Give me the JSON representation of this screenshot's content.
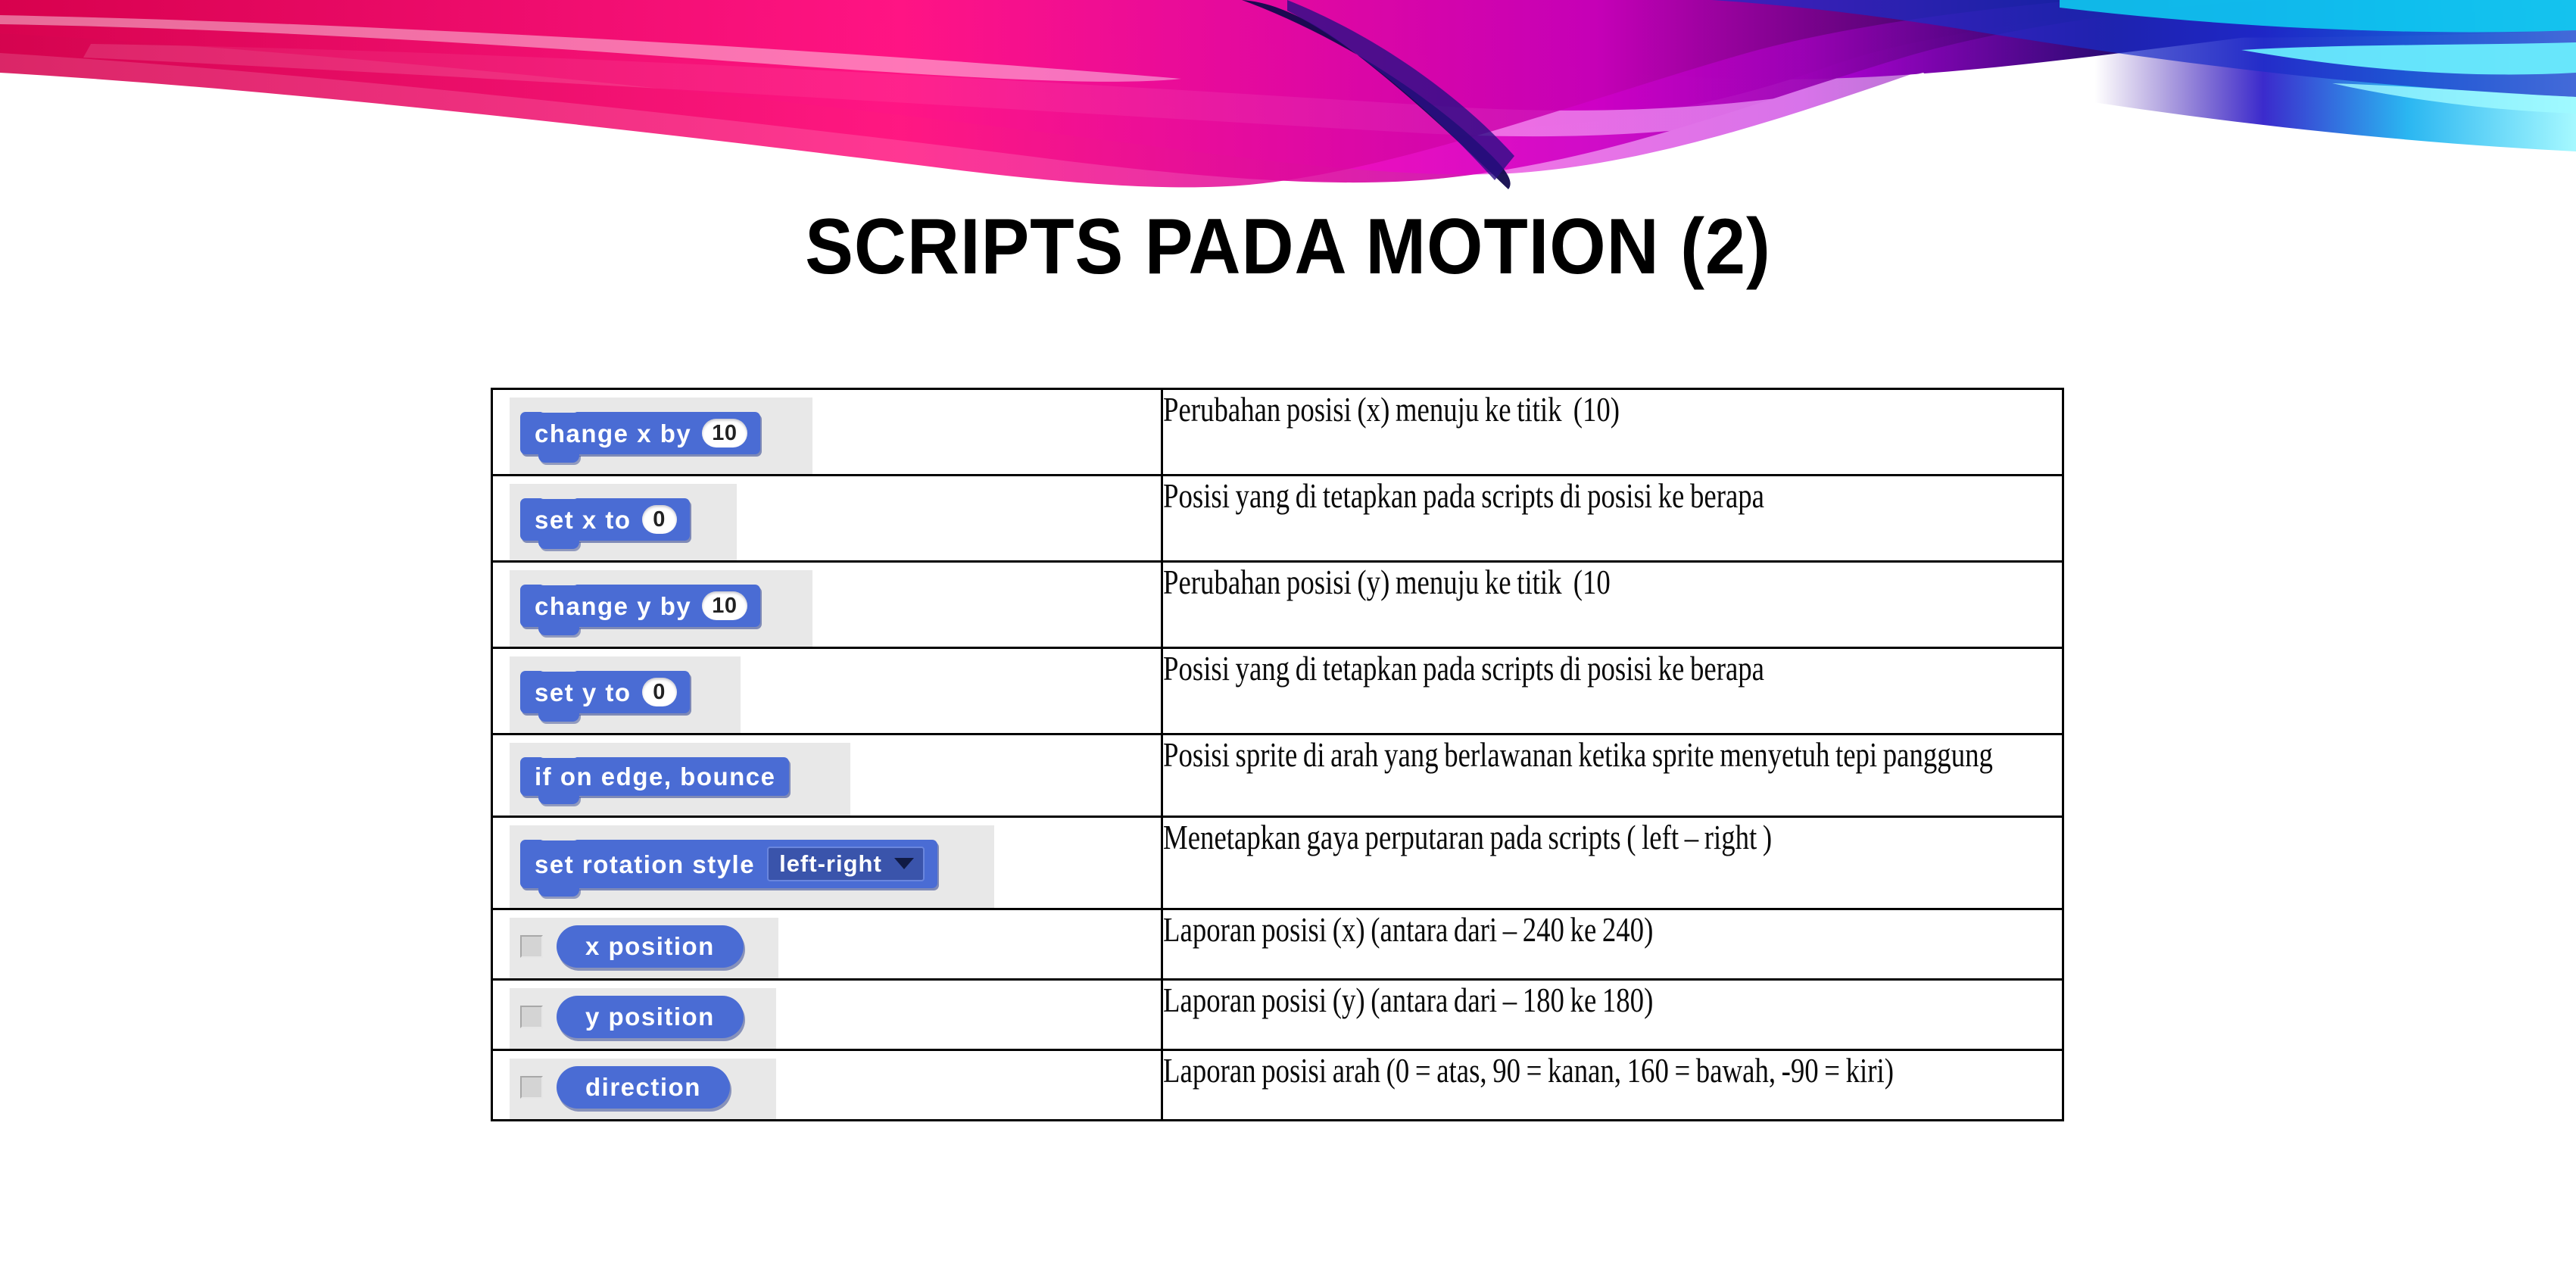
{
  "slide": {
    "title": "SCRIPTS PADA MOTION (2)"
  },
  "colors": {
    "block_blue": "#4a6cd4",
    "block_shadow": "#2c3c8c",
    "dropdown_blue": "#3a54ab",
    "block_backdrop_gray": "#e8e8e8",
    "checkbox_gray": "#d4d4d4",
    "banner_magenta": "#ff00c8",
    "banner_pink": "#ff2070",
    "banner_navy": "#140a5a",
    "banner_cyan": "#20e0f0",
    "table_border": "#000000",
    "text_black": "#0a0a0a"
  },
  "table": {
    "rows": [
      {
        "id": "change-x-by",
        "block": {
          "kind": "stack",
          "label": "change x by",
          "input_value": "10",
          "backdrop_width": 400
        },
        "description": "Perubahan posisi (x) menuju ke titik  (10)"
      },
      {
        "id": "set-x-to",
        "block": {
          "kind": "stack",
          "label": "set x to",
          "input_value": "0",
          "backdrop_width": 300
        },
        "description": "Posisi yang di tetapkan pada scripts di posisi ke berapa"
      },
      {
        "id": "change-y-by",
        "block": {
          "kind": "stack",
          "label": "change y by",
          "input_value": "10",
          "backdrop_width": 400
        },
        "description": "Perubahan posisi (y) menuju ke titik  (10"
      },
      {
        "id": "set-y-to",
        "block": {
          "kind": "stack",
          "label": "set y to",
          "input_value": "0",
          "backdrop_width": 305
        },
        "description": "Posisi yang di tetapkan pada scripts di posisi ke berapa"
      },
      {
        "id": "if-on-edge-bounce",
        "block": {
          "kind": "stack",
          "label": "if on edge, bounce",
          "input_value": "",
          "backdrop_width": 450
        },
        "description": "Posisi sprite di arah yang berlawanan ketika sprite menyetuh tepi panggung"
      },
      {
        "id": "set-rotation-style",
        "block": {
          "kind": "stack-dropdown",
          "label": "set rotation style",
          "dropdown_value": "left-right",
          "backdrop_width": 640
        },
        "description": "Menetapkan gaya perputaran pada scripts ( left – right )"
      },
      {
        "id": "x-position",
        "block": {
          "kind": "reporter",
          "label": "x position",
          "checkbox": true,
          "checkbox_checked": false,
          "backdrop_width": 355
        },
        "description": "Laporan posisi (x) (antara dari – 240 ke 240)"
      },
      {
        "id": "y-position",
        "block": {
          "kind": "reporter",
          "label": "y position",
          "checkbox": true,
          "checkbox_checked": false,
          "backdrop_width": 352
        },
        "description": "Laporan posisi (y) (antara dari – 180 ke 180)"
      },
      {
        "id": "direction",
        "block": {
          "kind": "reporter",
          "label": "direction",
          "checkbox": true,
          "checkbox_checked": false,
          "backdrop_width": 352
        },
        "description": "Laporan posisi arah (0 = atas, 90 = kanan, 160 = bawah, -90 = kiri)"
      }
    ]
  }
}
